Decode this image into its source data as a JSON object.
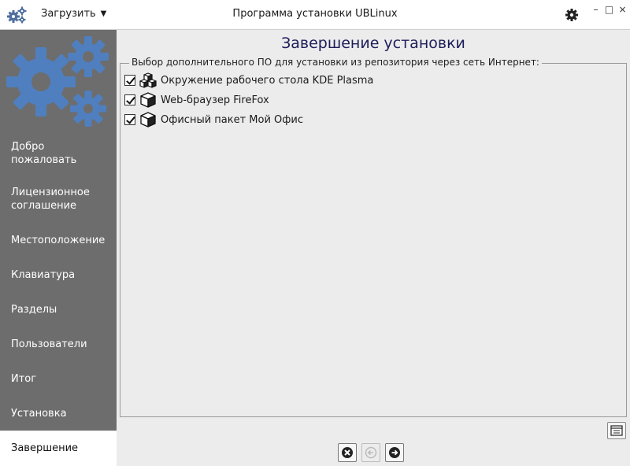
{
  "titlebar": {
    "load_label": "Загрузить",
    "title": "Программа установки UBLinux",
    "app_icon": "gears-icon",
    "settings_icon": "gear-icon",
    "window_buttons": {
      "minimize": "–",
      "maximize": "□",
      "close": "×"
    }
  },
  "sidebar": {
    "items": [
      {
        "label": "Добро\nпожаловать"
      },
      {
        "label": "Лицензионное\nсоглашение"
      },
      {
        "label": "Местоположение"
      },
      {
        "label": "Клавиатура"
      },
      {
        "label": "Разделы"
      },
      {
        "label": "Пользователи"
      },
      {
        "label": "Итог"
      },
      {
        "label": "Установка"
      },
      {
        "label": "Завершение",
        "active": true
      }
    ]
  },
  "main": {
    "title": "Завершение установки",
    "group_label": "Выбор дополнительного ПО для установки из репозитория через сеть Интернет:",
    "software": [
      {
        "label": "Окружение рабочего стола KDE Plasma",
        "checked": true,
        "icon": "packages-icon"
      },
      {
        "label": "Web-браузер FireFox",
        "checked": true,
        "icon": "package-icon"
      },
      {
        "label": "Офисный пакет Мой Офис",
        "checked": true,
        "icon": "package-icon"
      }
    ]
  },
  "colors": {
    "sidebar_bg": "#6d6d6d",
    "logo_blue": "#4f7fbf",
    "title_color": "#1d1d5a"
  }
}
